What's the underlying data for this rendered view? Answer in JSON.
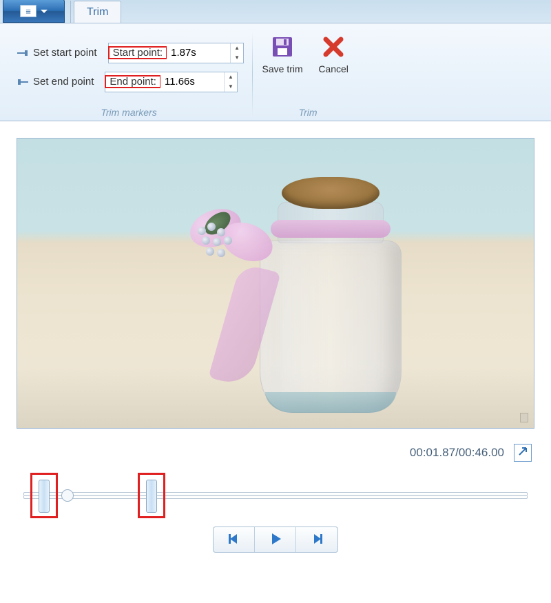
{
  "menubar": {
    "tab_trim": "Trim"
  },
  "ribbon": {
    "set_start_label": "Set start point",
    "set_end_label": "Set end point",
    "start_point_label": "Start point:",
    "end_point_label": "End point:",
    "start_point_value": "1.87s",
    "end_point_value": "11.66s",
    "group_markers_label": "Trim markers",
    "save_trim_label": "Save trim",
    "cancel_label": "Cancel",
    "group_trim_label": "Trim"
  },
  "preview": {
    "time_display": "00:01.87/00:46.00"
  },
  "timeline": {
    "total_seconds": 46.0,
    "start_trim_seconds": 1.87,
    "end_trim_seconds": 11.66,
    "playhead_seconds": 4.0
  },
  "colors": {
    "accent_blue": "#2d6fb5",
    "highlight_red": "#e02020",
    "save_purple": "#7a4fb5",
    "cancel_red": "#d63a2d"
  },
  "icons": {
    "menu": "menu-dropdown-icon",
    "save": "floppy-disk-icon",
    "cancel": "x-icon",
    "expand": "expand-arrow-icon",
    "prev_frame": "step-back-icon",
    "play": "play-icon",
    "next_frame": "step-forward-icon",
    "start_marker": "trim-start-icon",
    "end_marker": "trim-end-icon"
  }
}
